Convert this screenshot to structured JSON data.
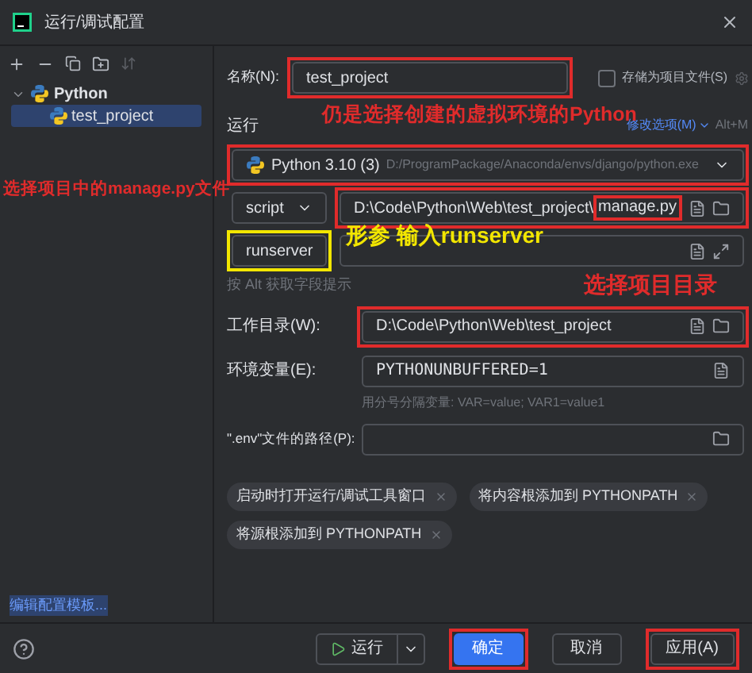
{
  "window": {
    "title": "运行/调试配置"
  },
  "sidebar": {
    "tree": [
      {
        "label": "Python",
        "expanded": true,
        "children": [
          {
            "label": "test_project",
            "selected": true
          }
        ]
      }
    ],
    "footer_link": "编辑配置模板..."
  },
  "name": {
    "label": "名称(N):",
    "value": "test_project",
    "highlight": {
      "color": "#e02b2b"
    }
  },
  "store_as_file": {
    "label": "存储为项目文件(S)",
    "checked": false
  },
  "run_section": {
    "title": "运行",
    "modify_options": "修改选项(M)",
    "shortcut": "Alt+M"
  },
  "interpreter": {
    "name": "Python 3.10 (3)",
    "path": "D:/ProgramPackage/Anaconda/envs/django/python.exe",
    "highlight": {
      "color": "#e02b2b"
    }
  },
  "script": {
    "type": "script",
    "path": "D:\\Code\\Python\\Web\\test_project\\",
    "file": "manage.py",
    "highlight": {
      "color": "#e02b2b"
    },
    "file_highlight": {
      "color": "#e02b2b"
    }
  },
  "parameters": {
    "value": "runserver",
    "highlight": {
      "color": "#f2e600"
    }
  },
  "field_hint": "按 Alt 获取字段提示",
  "working_dir": {
    "label": "工作目录(W):",
    "value": "D:\\Code\\Python\\Web\\test_project",
    "highlight": {
      "color": "#e02b2b"
    }
  },
  "env_vars": {
    "label": "环境变量(E):",
    "value": "PYTHONUNBUFFERED=1",
    "hint": "用分号分隔变量: VAR=value; VAR1=value1"
  },
  "env_file": {
    "label": "\".env\"文件的路径(P):"
  },
  "options": [
    {
      "label": "启动时打开运行/调试工具窗口"
    },
    {
      "label": "将内容根添加到 PYTHONPATH"
    },
    {
      "label": "将源根添加到 PYTHONPATH"
    }
  ],
  "annotations": [
    {
      "text": "仍是选择创建的虚拟环境的Python",
      "color": "#e02b2b"
    },
    {
      "text": "选择项目中的manage.py文件",
      "color": "#e02b2b"
    },
    {
      "text": "形参 输入runserver",
      "color": "#f2e600"
    },
    {
      "text": "选择项目目录",
      "color": "#e02b2b"
    }
  ],
  "buttons": [
    {
      "label": "运行",
      "kind": "split"
    },
    {
      "label": "确定",
      "kind": "primary",
      "highlight": {
        "color": "#e02b2b"
      }
    },
    {
      "label": "取消",
      "kind": "normal"
    },
    {
      "label": "应用(A)",
      "kind": "normal",
      "highlight": {
        "color": "#e02b2b"
      }
    }
  ]
}
